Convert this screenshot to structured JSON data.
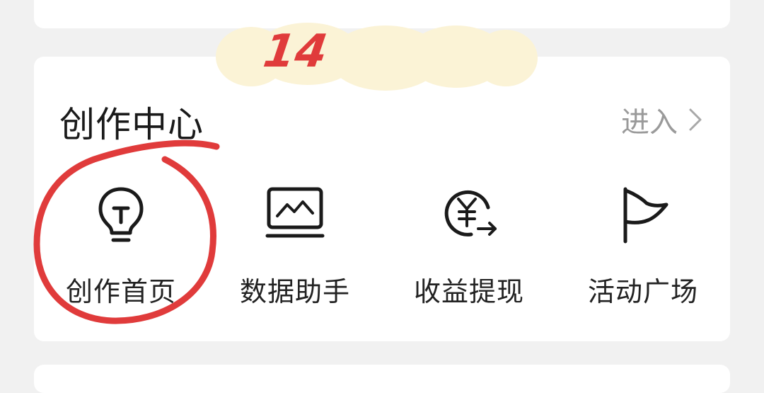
{
  "section": {
    "title": "创作中心",
    "enter_label": "进入"
  },
  "tiles": [
    {
      "label": "创作首页",
      "icon": "lightbulb-icon"
    },
    {
      "label": "数据助手",
      "icon": "chart-monitor-icon"
    },
    {
      "label": "收益提现",
      "icon": "yuan-withdraw-icon"
    },
    {
      "label": "活动广场",
      "icon": "flag-icon"
    }
  ],
  "annotation": {
    "number": "14",
    "color": "#e03b3b",
    "highlight_color": "#fbf3d6"
  }
}
